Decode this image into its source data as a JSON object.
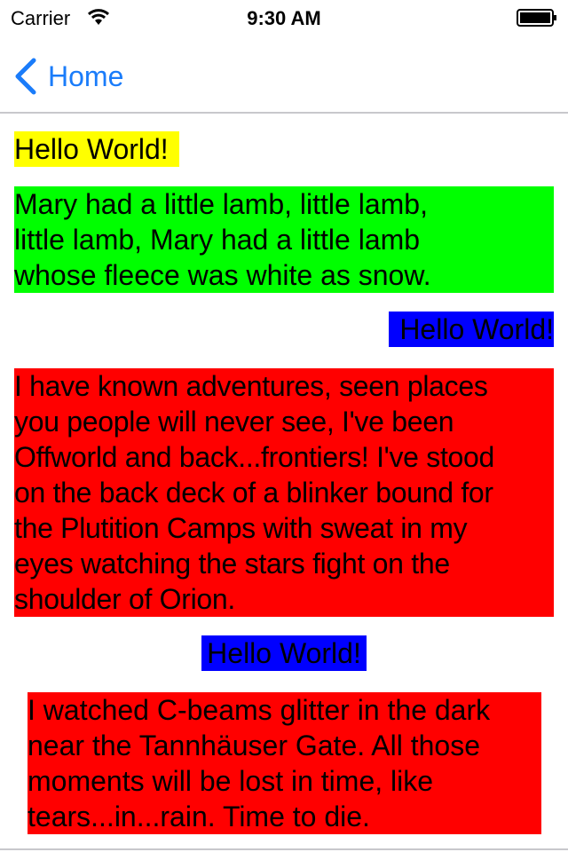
{
  "status_bar": {
    "carrier": "Carrier",
    "time": "9:30 AM",
    "wifi_icon": "wifi-icon",
    "battery_icon": "battery-icon"
  },
  "nav": {
    "back_label": "Home",
    "back_icon": "chevron-left-icon",
    "tint_color": "#1a7cfa"
  },
  "labels": [
    {
      "text": "Hello World!",
      "background": "#ffff00",
      "align": "left"
    },
    {
      "text": "Mary had a little lamb, little lamb,\nlittle lamb, Mary had a little lamb\nwhose fleece was white as snow.",
      "background": "#00ff00",
      "align": "left"
    },
    {
      "text": "Hello World!",
      "background": "#0000ff",
      "align": "right"
    },
    {
      "text": "I have known adventures, seen places\nyou people will never see, I've been\nOffworld and back...frontiers! I've stood\non the back deck of a blinker bound for\nthe Plutition Camps with sweat in my\neyes watching the stars fight on the\nshoulder of Orion.",
      "background": "#ff0000",
      "align": "left"
    },
    {
      "text": "Hello World!",
      "background": "#0000ff",
      "align": "center"
    },
    {
      "text": "I watched C-beams glitter in the dark\nnear the Tannhäuser Gate. All those\nmoments will be lost in time, like\ntears...in...rain. Time to die.",
      "background": "#ff0000",
      "align": "left"
    }
  ]
}
